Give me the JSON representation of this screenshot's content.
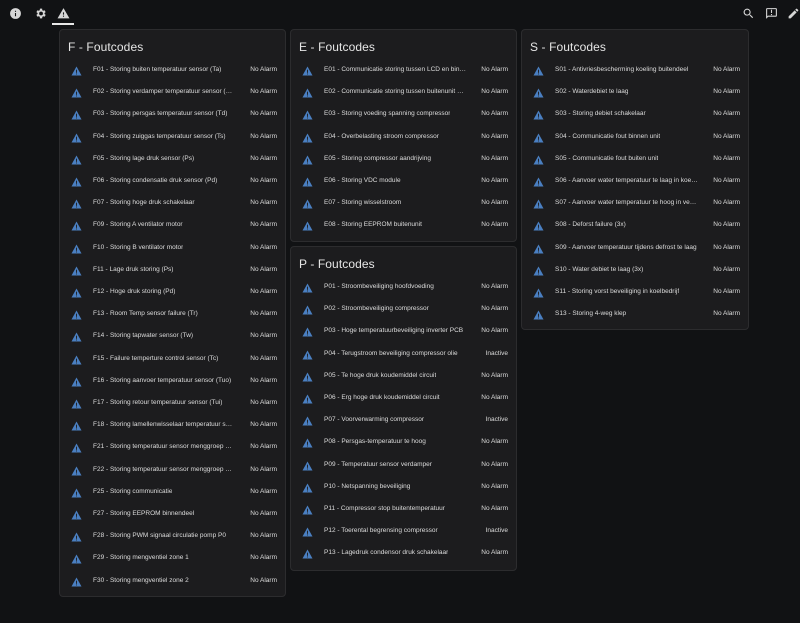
{
  "toolbar": {
    "left_icons": [
      "info-icon",
      "gear-icon",
      "warning-icon"
    ],
    "right_icons": [
      "search-icon",
      "chat-icon",
      "pencil-icon"
    ]
  },
  "cards": {
    "f": {
      "title": "F - Foutcodes",
      "rows": [
        {
          "name": "F01 - Storing buiten temperatuur sensor (Ta)",
          "state": "No Alarm"
        },
        {
          "name": "F02 - Storing verdamper temperatuur sensor (Tp)",
          "state": "No Alarm"
        },
        {
          "name": "F03 - Storing persgas temperatuur sensor (Td)",
          "state": "No Alarm"
        },
        {
          "name": "F04 - Storing zuiggas temperatuur sensor (Ts)",
          "state": "No Alarm"
        },
        {
          "name": "F05 - Storing lage druk sensor (Ps)",
          "state": "No Alarm"
        },
        {
          "name": "F06 - Storing condensatie druk sensor (Pd)",
          "state": "No Alarm"
        },
        {
          "name": "F07 - Storing hoge druk schakelaar",
          "state": "No Alarm"
        },
        {
          "name": "F09 - Storing A ventilator motor",
          "state": "No Alarm"
        },
        {
          "name": "F10 - Storing B ventilator motor",
          "state": "No Alarm"
        },
        {
          "name": "F11 - Lage druk storing (Ps)",
          "state": "No Alarm"
        },
        {
          "name": "F12 - Hoge druk storing (Pd)",
          "state": "No Alarm"
        },
        {
          "name": "F13 - Room Temp sensor failure (Tr)",
          "state": "No Alarm"
        },
        {
          "name": "F14 - Storing tapwater sensor (Tw)",
          "state": "No Alarm"
        },
        {
          "name": "F15 - Failure temperture control sensor (Tc)",
          "state": "No Alarm"
        },
        {
          "name": "F16 - Storing aanvoer temperatuur sensor (Tuo)",
          "state": "No Alarm"
        },
        {
          "name": "F17 - Storing retour temperatuur sensor (Tui)",
          "state": "No Alarm"
        },
        {
          "name": "F18 - Storing lamellenwisselaar temperatuur sensor ...",
          "state": "No Alarm"
        },
        {
          "name": "F21 - Storing temperatuur sensor menggroep 1 (Tv1)",
          "state": "No Alarm"
        },
        {
          "name": "F22 - Storing temperatuur sensor menggroep 2 (Tv2)",
          "state": "No Alarm"
        },
        {
          "name": "F25 - Storing communicatie",
          "state": "No Alarm"
        },
        {
          "name": "F27 - Storing EEPROM binnendeel",
          "state": "No Alarm"
        },
        {
          "name": "F28 - Storing PWM signaal circulatie pomp P0",
          "state": "No Alarm"
        },
        {
          "name": "F29 - Storing mengventiel zone 1",
          "state": "No Alarm"
        },
        {
          "name": "F30 - Storing mengventiel zone 2",
          "state": "No Alarm"
        }
      ]
    },
    "e": {
      "title": "E - Foutcodes",
      "rows": [
        {
          "name": "E01 - Communicatie storing tussen LCD en binnenunit",
          "state": "No Alarm"
        },
        {
          "name": "E02 - Communicatie storing tussen buitenunit PCB e...",
          "state": "No Alarm"
        },
        {
          "name": "E03 - Storing voeding spanning compressor",
          "state": "No Alarm"
        },
        {
          "name": "E04 - Overbelasting stroom compressor",
          "state": "No Alarm"
        },
        {
          "name": "E05 - Storing compressor aandrijving",
          "state": "No Alarm"
        },
        {
          "name": "E06 - Storing VDC module",
          "state": "No Alarm"
        },
        {
          "name": "E07 - Storing wisselstroom",
          "state": "No Alarm"
        },
        {
          "name": "E08 - Storing EEPROM buitenunit",
          "state": "No Alarm"
        }
      ]
    },
    "p": {
      "title": "P - Foutcodes",
      "rows": [
        {
          "name": "P01 - Stroombeveiliging hoofdvoeding",
          "state": "No Alarm"
        },
        {
          "name": "P02 - Stroombeveiliging compressor",
          "state": "No Alarm"
        },
        {
          "name": "P03 - Hoge temperatuurbeveiliging inverter PCB",
          "state": "No Alarm"
        },
        {
          "name": "P04 - Terugstroom beveiliging compressor olie",
          "state": "Inactive"
        },
        {
          "name": "P05 - Te hoge druk koudemiddel circuit",
          "state": "No Alarm"
        },
        {
          "name": "P06 - Erg hoge druk koudemiddel circuit",
          "state": "No Alarm"
        },
        {
          "name": "P07 - Voorverwarming compressor",
          "state": "Inactive"
        },
        {
          "name": "P08 - Persgas-temperatuur te hoog",
          "state": "No Alarm"
        },
        {
          "name": "P09 - Temperatuur sensor verdamper",
          "state": "No Alarm"
        },
        {
          "name": "P10 - Netspanning beveiliging",
          "state": "No Alarm"
        },
        {
          "name": "P11 - Compressor stop buitentemperatuur",
          "state": "No Alarm"
        },
        {
          "name": "P12 - Toerental begrensing compressor",
          "state": "Inactive"
        },
        {
          "name": "P13 - Lagedruk condensor druk schakelaar",
          "state": "No Alarm"
        }
      ]
    },
    "s": {
      "title": "S - Foutcodes",
      "rows": [
        {
          "name": "S01 - Antivriesbescherming koeling buitendeel",
          "state": "No Alarm"
        },
        {
          "name": "S02 - Waterdebiet te laag",
          "state": "No Alarm"
        },
        {
          "name": "S03 - Storing debiet schakelaar",
          "state": "No Alarm"
        },
        {
          "name": "S04 - Communicatie fout binnen unit",
          "state": "No Alarm"
        },
        {
          "name": "S05 - Communicatie fout buiten unit",
          "state": "No Alarm"
        },
        {
          "name": "S06 - Aanvoer water temperatuur te laag in koelen",
          "state": "No Alarm"
        },
        {
          "name": "S07 - Aanvoer water temperatuur te hoog in verwar...",
          "state": "No Alarm"
        },
        {
          "name": "S08 - Deforst failure (3x)",
          "state": "No Alarm"
        },
        {
          "name": "S09 - Aanvoer temperatuur tijdens defrost te laag",
          "state": "No Alarm"
        },
        {
          "name": "S10 - Water debiet te laag (3x)",
          "state": "No Alarm"
        },
        {
          "name": "S11 - Storing vorst beveiliging in koelbedrijf",
          "state": "No Alarm"
        },
        {
          "name": "S13 - Storing 4-weg klep",
          "state": "No Alarm"
        }
      ]
    }
  },
  "colors": {
    "background": "#111214",
    "card": "#1c1c1e",
    "alert_icon": "#4a7fc1"
  }
}
